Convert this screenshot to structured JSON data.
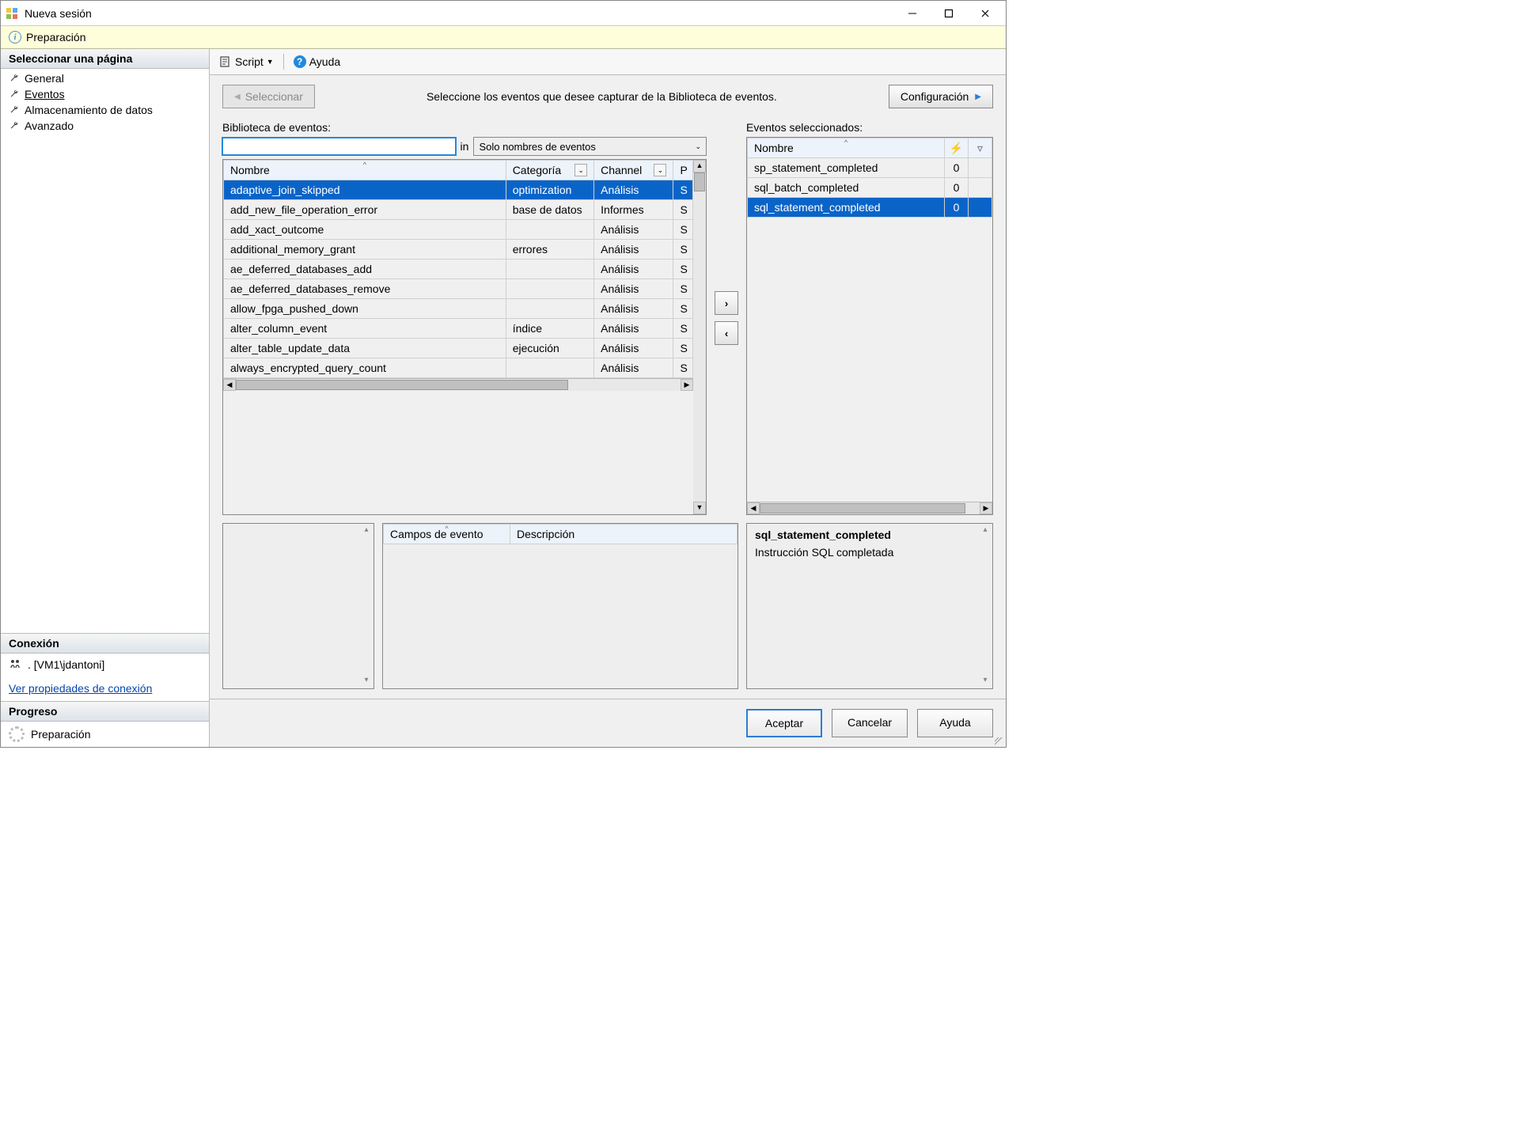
{
  "window": {
    "title": "Nueva sesión"
  },
  "status": {
    "text": "Preparación"
  },
  "sidebar": {
    "header": "Seleccionar una página",
    "items": [
      {
        "label": "General"
      },
      {
        "label": "Eventos"
      },
      {
        "label": "Almacenamiento de datos"
      },
      {
        "label": "Avanzado"
      }
    ]
  },
  "connection": {
    "header": "Conexión",
    "value": ". [VM1\\jdantoni]",
    "link": "Ver propiedades de conexión"
  },
  "progress": {
    "header": "Progreso",
    "value": "Preparación"
  },
  "toolbar": {
    "script": "Script",
    "help": "Ayuda"
  },
  "top": {
    "select_btn": "Seleccionar",
    "instruction": "Seleccione los eventos que desee capturar de la Biblioteca de eventos.",
    "config_btn": "Configuración"
  },
  "library": {
    "label": "Biblioteca de eventos:",
    "search_value": "",
    "in_label": "in",
    "filter_mode": "Solo nombres de eventos",
    "columns": {
      "name": "Nombre",
      "category": "Categoría",
      "channel": "Channel",
      "p": "P"
    },
    "rows": [
      {
        "name": "adaptive_join_skipped",
        "category": "optimization",
        "channel": "Análisis",
        "p": "S"
      },
      {
        "name": "add_new_file_operation_error",
        "category": "base de datos",
        "channel": "Informes",
        "p": "S"
      },
      {
        "name": "add_xact_outcome",
        "category": "",
        "channel": "Análisis",
        "p": "S"
      },
      {
        "name": "additional_memory_grant",
        "category": "errores",
        "channel": "Análisis",
        "p": "S"
      },
      {
        "name": "ae_deferred_databases_add",
        "category": "",
        "channel": "Análisis",
        "p": "S"
      },
      {
        "name": "ae_deferred_databases_remove",
        "category": "",
        "channel": "Análisis",
        "p": "S"
      },
      {
        "name": "allow_fpga_pushed_down",
        "category": "",
        "channel": "Análisis",
        "p": "S"
      },
      {
        "name": "alter_column_event",
        "category": "índice",
        "channel": "Análisis",
        "p": "S"
      },
      {
        "name": "alter_table_update_data",
        "category": "ejecución",
        "channel": "Análisis",
        "p": "S"
      },
      {
        "name": "always_encrypted_query_count",
        "category": "",
        "channel": "Análisis",
        "p": "S"
      }
    ]
  },
  "selected": {
    "label": "Eventos seleccionados:",
    "columns": {
      "name": "Nombre"
    },
    "rows": [
      {
        "name": "sp_statement_completed",
        "count": "0"
      },
      {
        "name": "sql_batch_completed",
        "count": "0"
      },
      {
        "name": "sql_statement_completed",
        "count": "0"
      }
    ]
  },
  "fields_panel": {
    "col_name": "Campos de evento",
    "col_desc": "Descripción"
  },
  "description_panel": {
    "title": "sql_statement_completed",
    "body": "Instrucción SQL completada"
  },
  "buttons": {
    "ok": "Aceptar",
    "cancel": "Cancelar",
    "help": "Ayuda"
  }
}
